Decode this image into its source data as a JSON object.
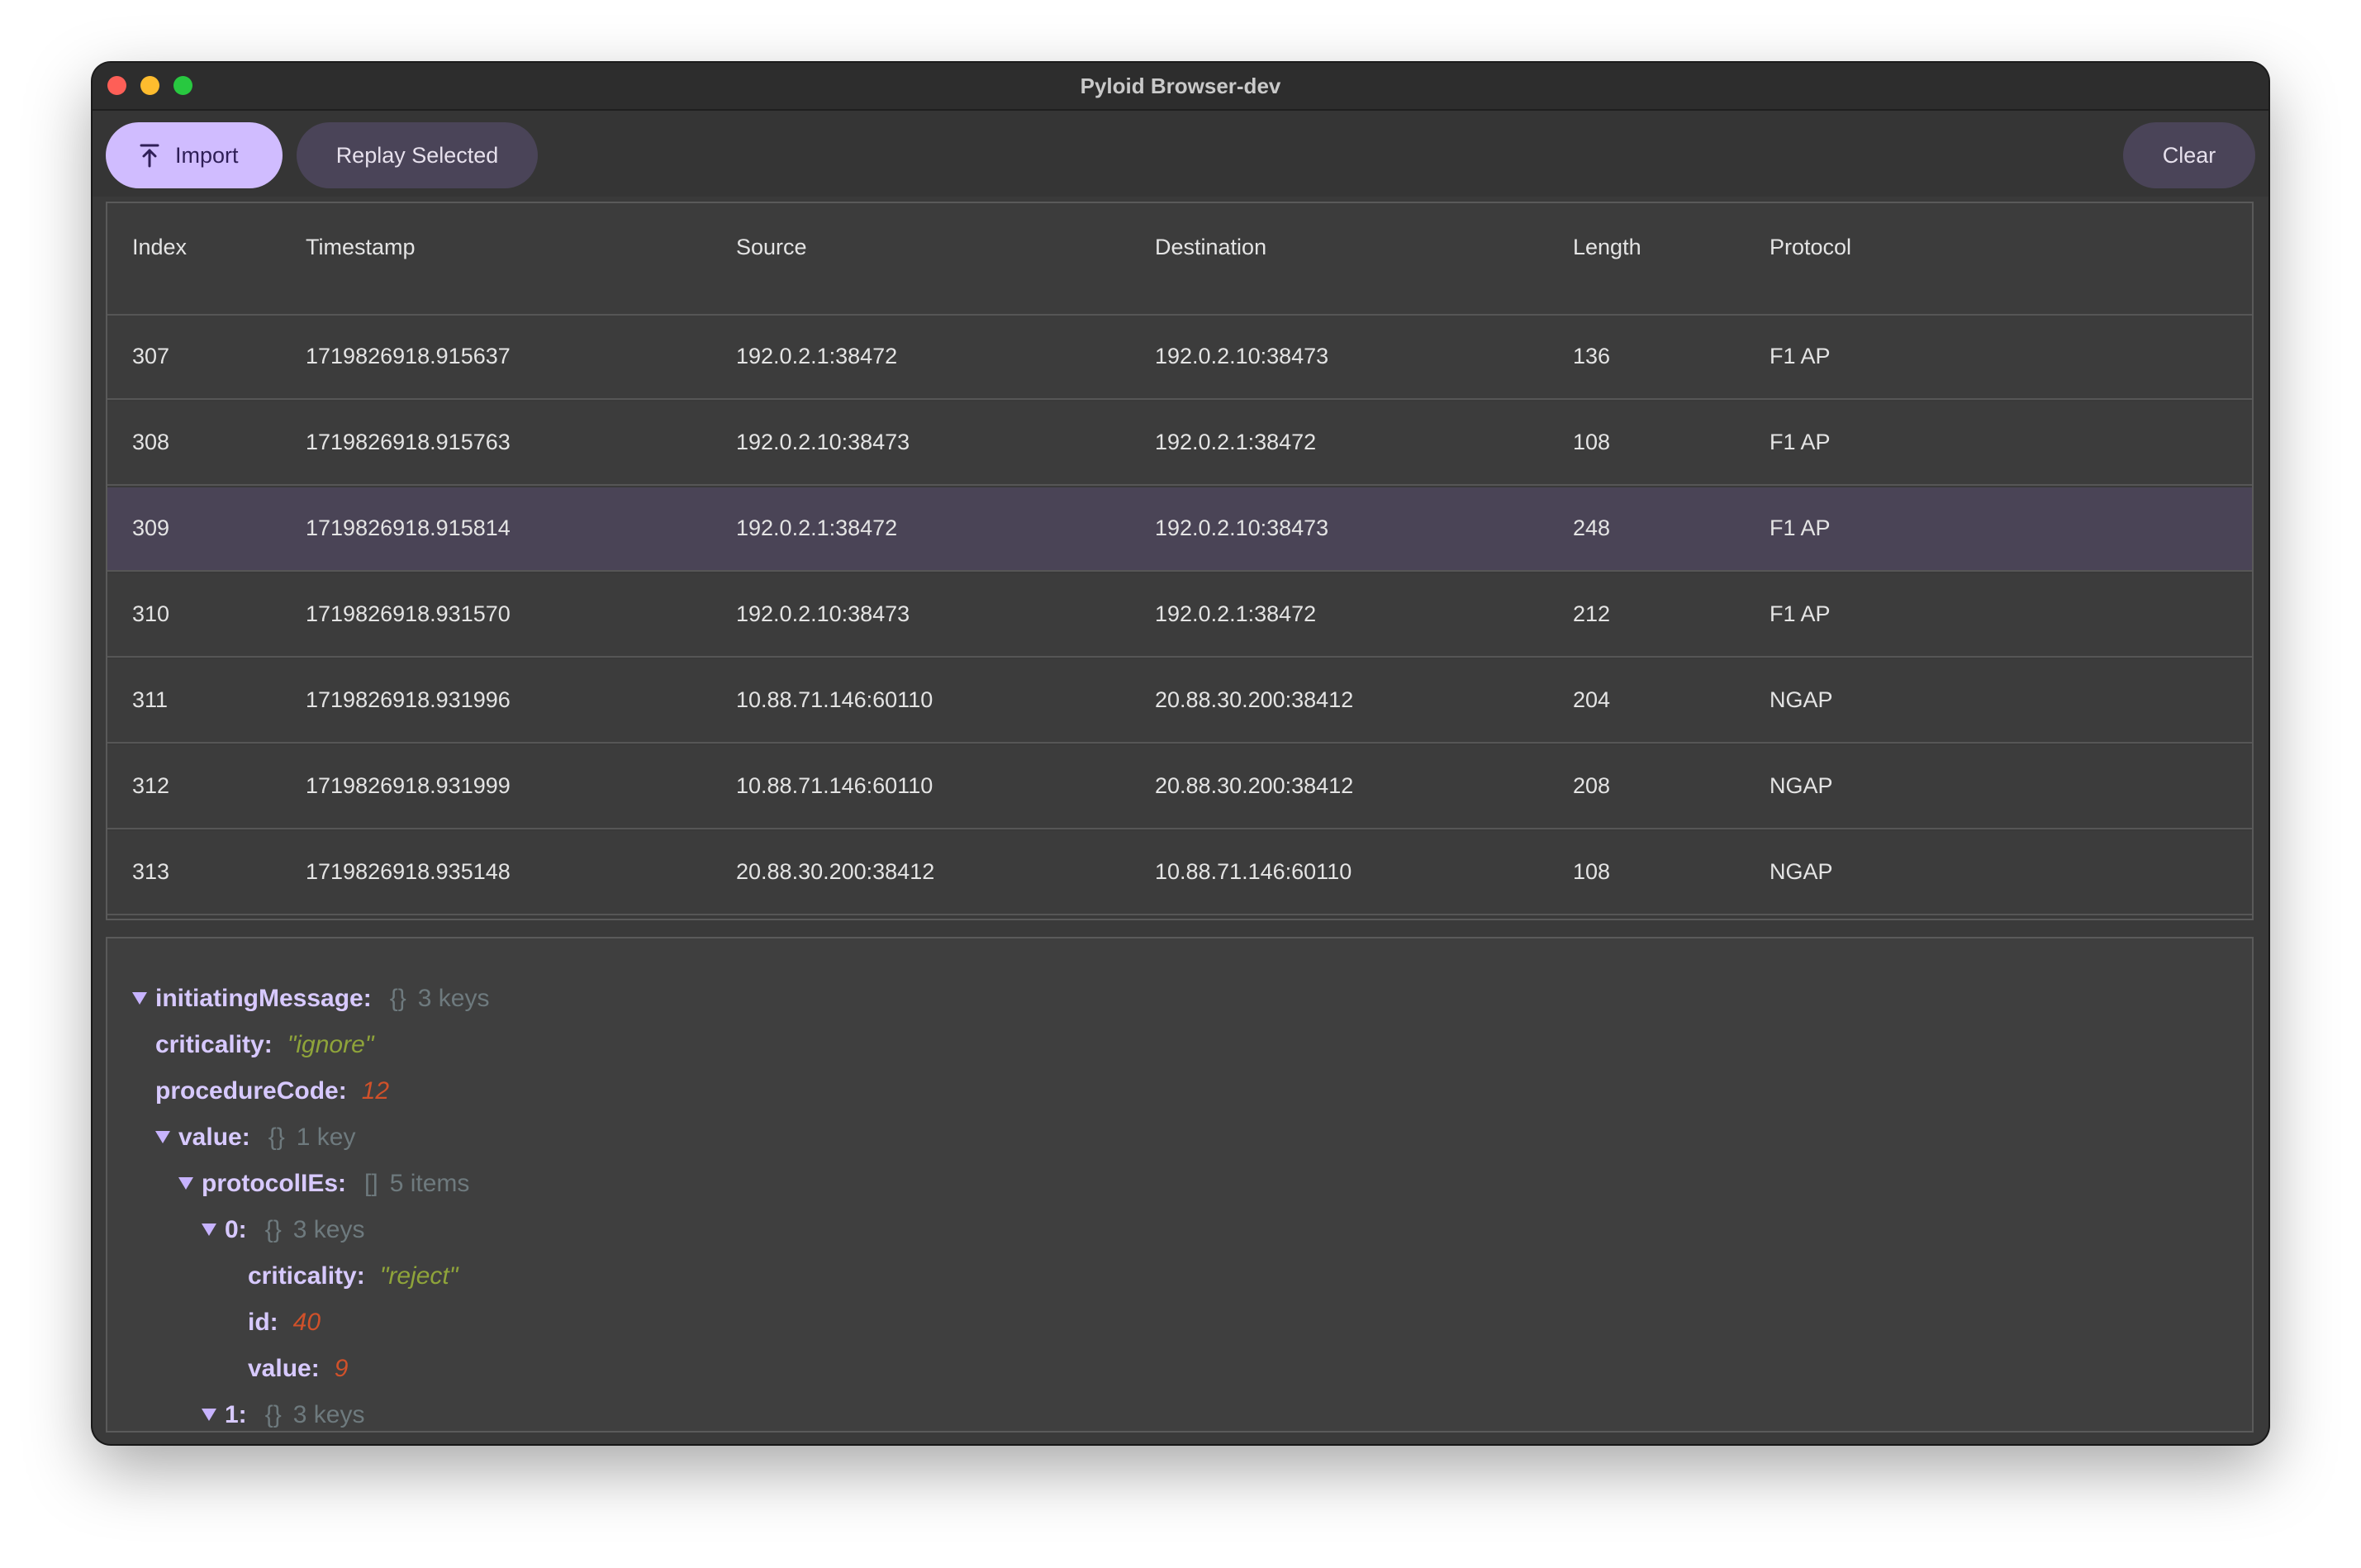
{
  "window": {
    "title": "Pyloid Browser-dev"
  },
  "toolbar": {
    "import_label": "Import",
    "replay_label": "Replay Selected",
    "clear_label": "Clear"
  },
  "table": {
    "columns": [
      "Index",
      "Timestamp",
      "Source",
      "Destination",
      "Length",
      "Protocol"
    ],
    "rows": [
      [
        "307",
        "1719826918.915637",
        "192.0.2.1:38472",
        "192.0.2.10:38473",
        "136",
        "F1 AP"
      ],
      [
        "308",
        "1719826918.915763",
        "192.0.2.10:38473",
        "192.0.2.1:38472",
        "108",
        "F1 AP"
      ],
      [
        "309",
        "1719826918.915814",
        "192.0.2.1:38472",
        "192.0.2.10:38473",
        "248",
        "F1 AP"
      ],
      [
        "310",
        "1719826918.931570",
        "192.0.2.10:38473",
        "192.0.2.1:38472",
        "212",
        "F1 AP"
      ],
      [
        "311",
        "1719826918.931996",
        "10.88.71.146:60110",
        "20.88.30.200:38412",
        "204",
        "NGAP"
      ],
      [
        "312",
        "1719826918.931999",
        "10.88.71.146:60110",
        "20.88.30.200:38412",
        "208",
        "NGAP"
      ],
      [
        "313",
        "1719826918.935148",
        "20.88.30.200:38412",
        "10.88.71.146:60110",
        "108",
        "NGAP"
      ]
    ],
    "selected_index": "309"
  },
  "detail": {
    "nodes": [
      {
        "key": "initiatingMessage:",
        "brace": "{}",
        "meta": "3 keys",
        "expandable": true
      },
      {
        "key": "criticality:",
        "str": "\"ignore\""
      },
      {
        "key": "procedureCode:",
        "num": "12"
      },
      {
        "key": "value:",
        "brace": "{}",
        "meta": "1 key",
        "expandable": true
      },
      {
        "key": "protocolIEs:",
        "brace": "[]",
        "meta": "5 items",
        "expandable": true
      },
      {
        "key": "0:",
        "brace": "{}",
        "meta": "3 keys",
        "expandable": true
      },
      {
        "key": "criticality:",
        "str": "\"reject\""
      },
      {
        "key": "id:",
        "num": "40"
      },
      {
        "key": "value:",
        "num": "9"
      },
      {
        "key": "1:",
        "brace": "{}",
        "meta": "3 keys",
        "expandable": true
      }
    ]
  },
  "colors": {
    "accent": "#d0bcff",
    "tonal_button": "#4a4458",
    "selected_row": "#4a4456",
    "string_value": "#8fa43a",
    "number_value": "#d0512a",
    "json_key": "#d7c9ff"
  },
  "icons": {
    "import": "upload-icon",
    "expand": "triangle-down-icon"
  }
}
